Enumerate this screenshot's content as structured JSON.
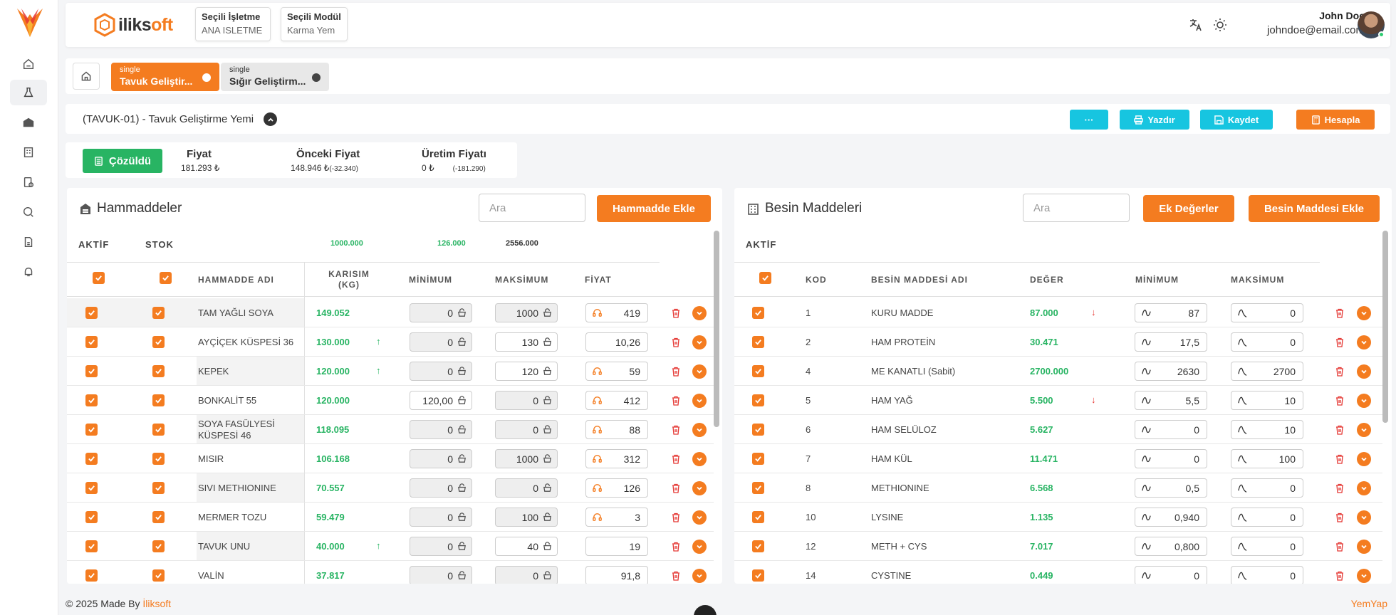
{
  "brand": {
    "name_pre": "iliks",
    "name_post": "oft"
  },
  "header": {
    "business": {
      "title": "Seçili İşletme",
      "value": "ANA ISLETME"
    },
    "module": {
      "title": "Seçili Modül",
      "value": "Karma Yem"
    },
    "user": {
      "name": "John Doe",
      "email": "johndoe@email.com"
    }
  },
  "tabs": [
    {
      "sub": "single",
      "label": "Tavuk Geliştir...",
      "active": true
    },
    {
      "sub": "single",
      "label": "Sığır Geliştirm...",
      "active": false
    }
  ],
  "titlebar": {
    "title": "(TAVUK-01) - Tavuk Geliştirme Yemi",
    "more": "···",
    "print": "Yazdır",
    "save": "Kaydet",
    "calc": "Hesapla"
  },
  "summary": {
    "status": "Çözüldü",
    "price_label": "Fiyat",
    "price_value": "181.293 ₺",
    "prev_label": "Önceki Fiyat",
    "prev_value": "148.946 ₺",
    "prev_diff": "(-32.340)",
    "prod_label": "Üretim Fiyatı",
    "prod_value": "0 ₺",
    "prod_diff": "(-181.290)"
  },
  "raw": {
    "title": "Hammaddeler",
    "search_placeholder": "Ara",
    "add": "Hammadde Ekle",
    "active_label": "AKTİF",
    "stock_label": "STOK",
    "totals": {
      "mix": "1000.000",
      "min": "126.000",
      "max": "2556.000"
    },
    "columns": {
      "name": "HAMMADDE ADI",
      "mix": "KARISIM (KG)",
      "min": "MİNİMUM",
      "max": "MAKSİMUM",
      "price": "FİYAT"
    },
    "rows": [
      {
        "name": "TAM YAĞLI SOYA",
        "mix": "149.052",
        "arrow": "",
        "min": "0",
        "max": "1000",
        "price": "419",
        "maxgray": true,
        "pricon": true
      },
      {
        "name": "AYÇİÇEK KÜSPESİ 36",
        "mix": "130.000",
        "arrow": "↑",
        "min": "0",
        "max": "130",
        "price": "10,26",
        "maxgray": false,
        "pricon": false
      },
      {
        "name": "KEPEK",
        "mix": "120.000",
        "arrow": "↑",
        "min": "0",
        "max": "120",
        "price": "59",
        "maxgray": false,
        "pricon": true
      },
      {
        "name": "BONKALİT 55",
        "mix": "120.000",
        "arrow": "",
        "min": "120,00",
        "max": "0",
        "price": "412",
        "maxgray": true,
        "pricon": true
      },
      {
        "name": "SOYA FASÜLYESİ KÜSPESİ 46",
        "mix": "118.095",
        "arrow": "",
        "min": "0",
        "max": "0",
        "price": "88",
        "maxgray": true,
        "pricon": true
      },
      {
        "name": "MISIR",
        "mix": "106.168",
        "arrow": "",
        "min": "0",
        "max": "1000",
        "price": "312",
        "maxgray": true,
        "pricon": true
      },
      {
        "name": "SIVI METHIONINE",
        "mix": "70.557",
        "arrow": "",
        "min": "0",
        "max": "0",
        "price": "126",
        "maxgray": true,
        "pricon": true
      },
      {
        "name": "MERMER TOZU",
        "mix": "59.479",
        "arrow": "",
        "min": "0",
        "max": "100",
        "price": "3",
        "maxgray": true,
        "pricon": true
      },
      {
        "name": "TAVUK UNU",
        "mix": "40.000",
        "arrow": "↑",
        "min": "0",
        "max": "40",
        "price": "19",
        "maxgray": false,
        "pricon": false
      },
      {
        "name": "VALİN",
        "mix": "37.817",
        "arrow": "",
        "min": "0",
        "max": "0",
        "price": "91,8",
        "maxgray": true,
        "pricon": false
      }
    ]
  },
  "nutr": {
    "title": "Besin Maddeleri",
    "search_placeholder": "Ara",
    "extra": "Ek Değerler",
    "add": "Besin Maddesi Ekle",
    "active_label": "AKTİF",
    "columns": {
      "code": "KOD",
      "name": "BESİN MADDESİ ADI",
      "value": "DEĞER",
      "min": "MİNİMUM",
      "max": "MAKSİMUM"
    },
    "rows": [
      {
        "code": "1",
        "name": "KURU MADDE",
        "value": "87.000",
        "arrow": "↓",
        "min": "87",
        "max": "0"
      },
      {
        "code": "2",
        "name": "HAM PROTEİN",
        "value": "30.471",
        "arrow": "",
        "min": "17,5",
        "max": "0"
      },
      {
        "code": "4",
        "name": "ME KANATLI (Sabit)",
        "value": "2700.000",
        "arrow": "",
        "min": "2630",
        "max": "2700"
      },
      {
        "code": "5",
        "name": "HAM YAĞ",
        "value": "5.500",
        "arrow": "↓",
        "min": "5,5",
        "max": "10"
      },
      {
        "code": "6",
        "name": "HAM SELÜLOZ",
        "value": "5.627",
        "arrow": "",
        "min": "0",
        "max": "10"
      },
      {
        "code": "7",
        "name": "HAM KÜL",
        "value": "11.471",
        "arrow": "",
        "min": "0",
        "max": "100"
      },
      {
        "code": "8",
        "name": "METHIONINE",
        "value": "6.568",
        "arrow": "",
        "min": "0,5",
        "max": "0"
      },
      {
        "code": "10",
        "name": "LYSINE",
        "value": "1.135",
        "arrow": "",
        "min": "0,940",
        "max": "0"
      },
      {
        "code": "12",
        "name": "METH + CYS",
        "value": "7.017",
        "arrow": "",
        "min": "0,800",
        "max": "0"
      },
      {
        "code": "14",
        "name": "CYSTINE",
        "value": "0.449",
        "arrow": "",
        "min": "0",
        "max": "0"
      }
    ]
  },
  "footer": {
    "left_pre": "© 2025 Made By ",
    "left_brand": "İliksoft",
    "right": "YemYap"
  },
  "colors": {
    "accent": "#f47c20",
    "success": "#28b463",
    "info": "#17c5e0",
    "danger": "#e53935"
  }
}
